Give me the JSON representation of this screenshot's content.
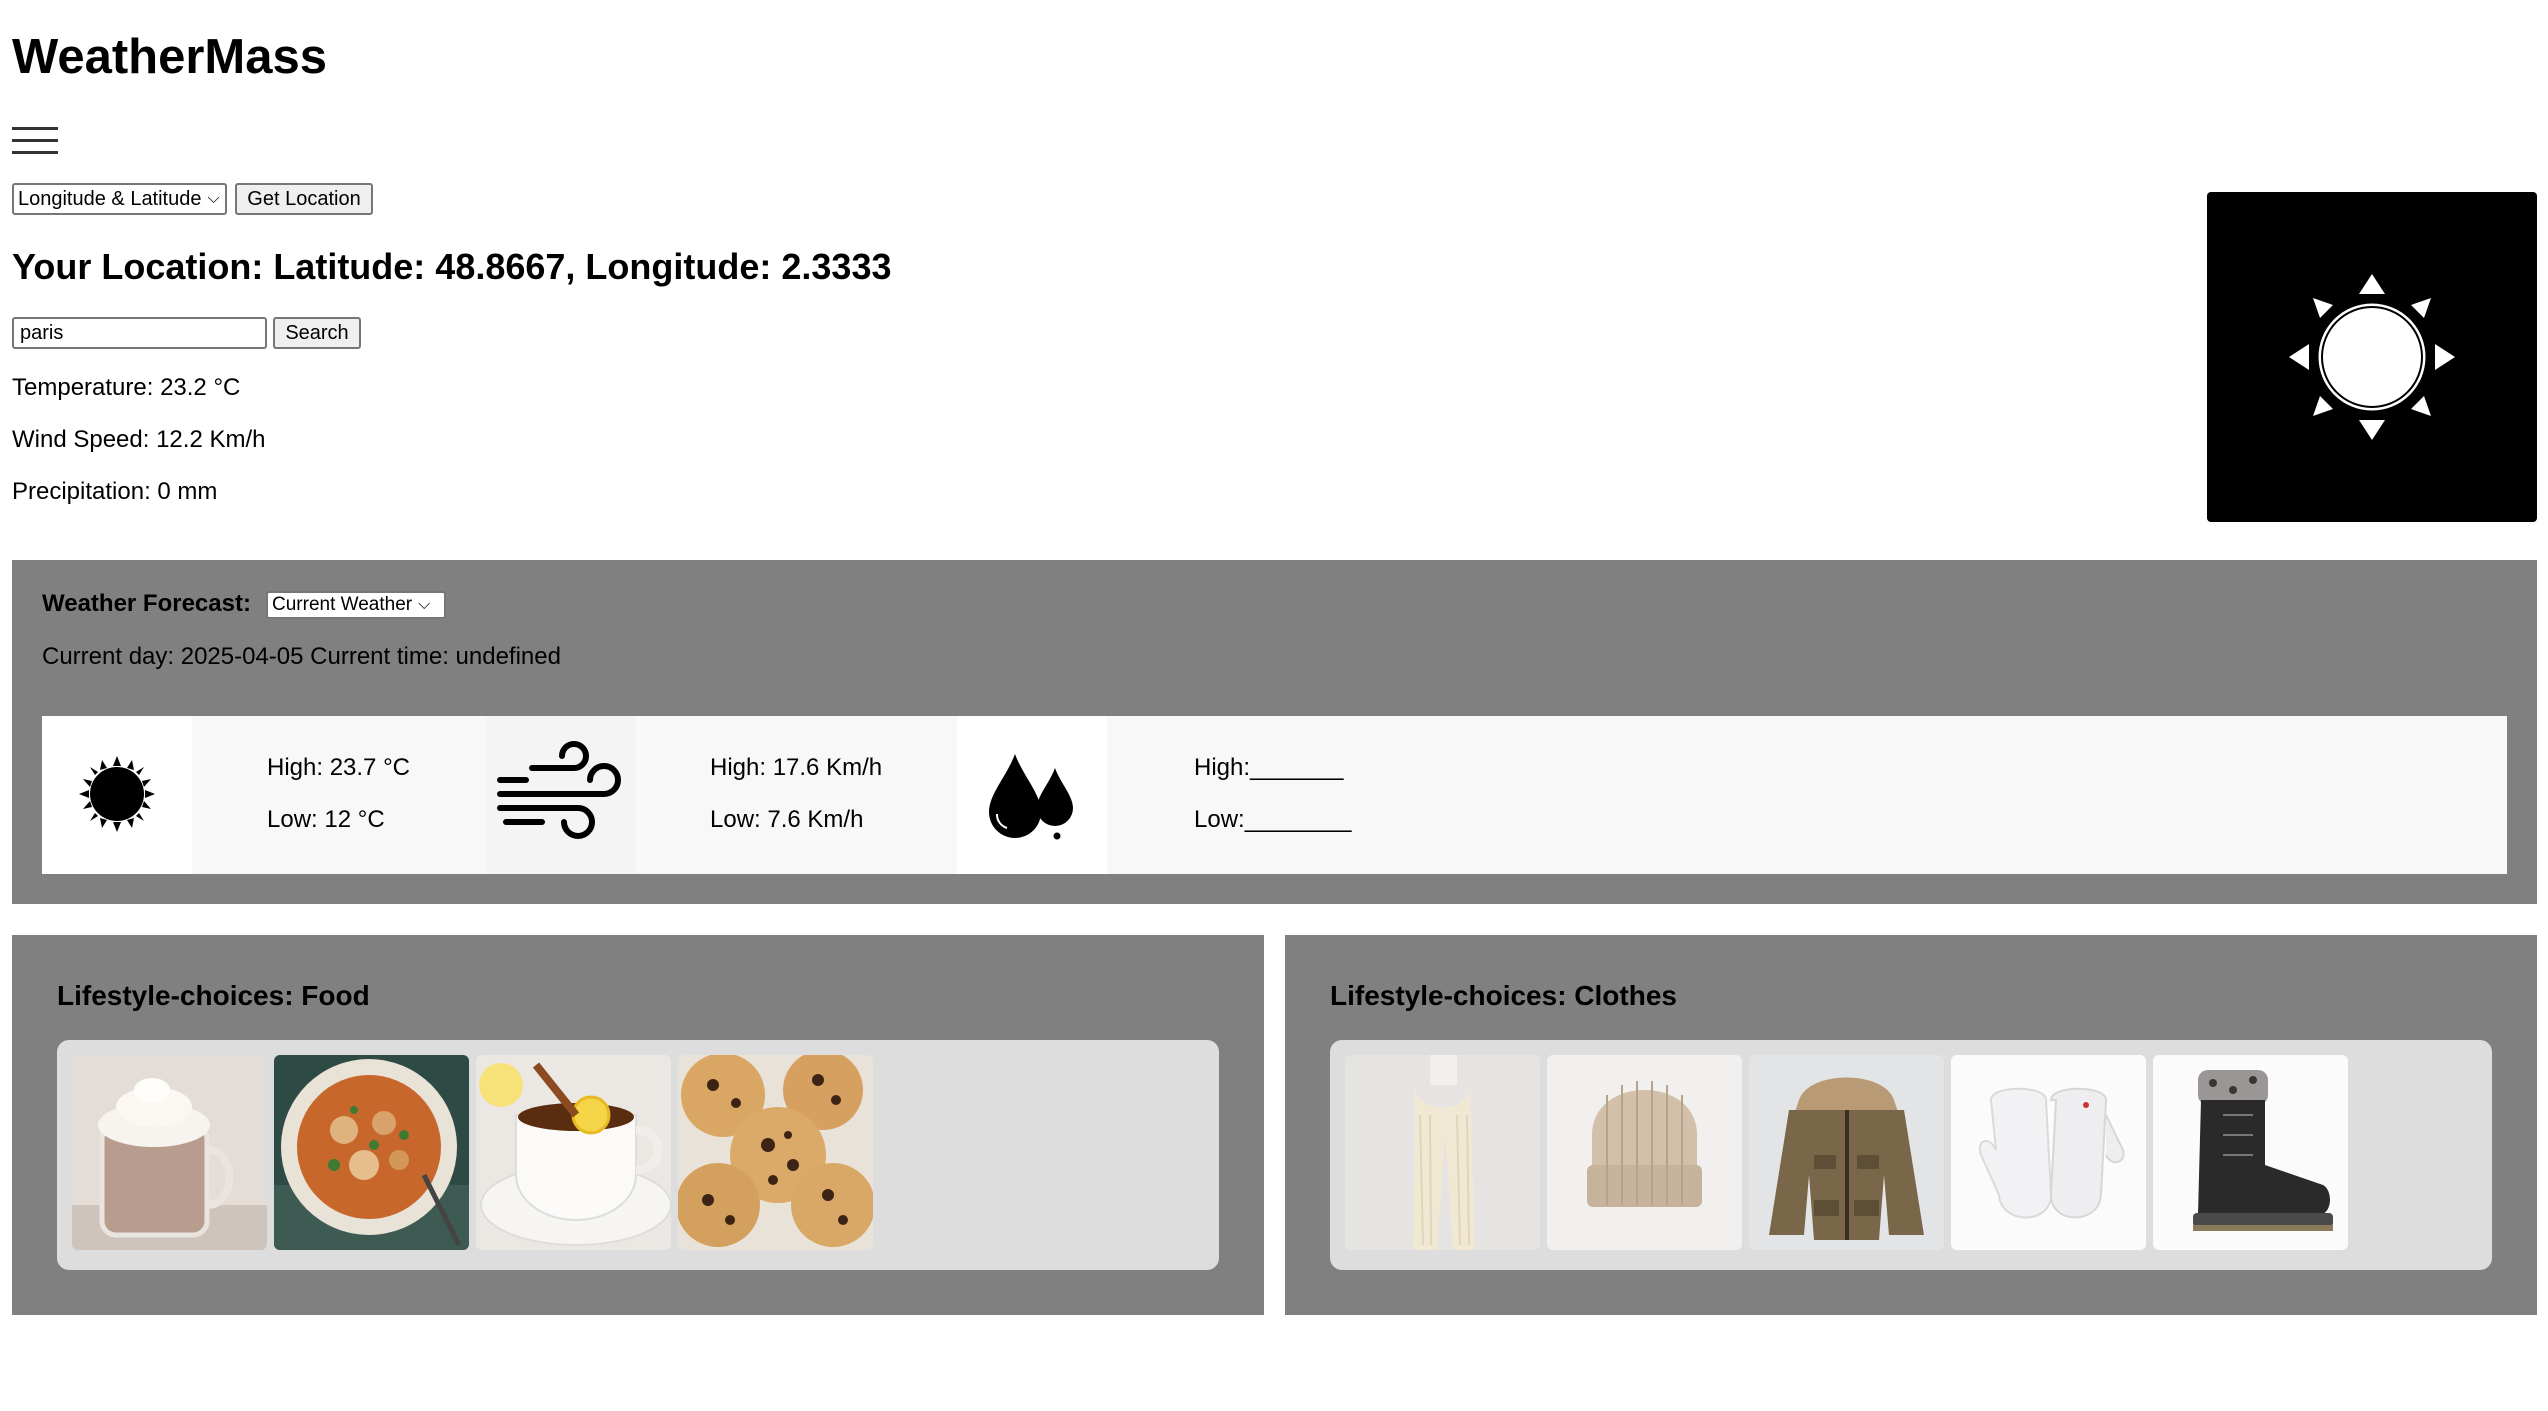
{
  "app": {
    "title": "WeatherMass"
  },
  "location": {
    "mode_select": "Longitude & Latitude",
    "get_location_label": "Get Location",
    "heading": "Your Location: Latitude: 48.8667, Longitude: 2.3333",
    "search_value": "paris",
    "search_label": "Search"
  },
  "current": {
    "temperature": "Temperature: 23.2 °C",
    "wind_speed": "Wind Speed: 12.2 Km/h",
    "precipitation": "Precipitation: 0 mm",
    "condition_icon": "sun-icon"
  },
  "forecast": {
    "label": "Weather Forecast:",
    "select_value": "Current Weather",
    "day_time": "Current day: 2025-04-05 Current time: undefined",
    "temperature": {
      "icon": "sun-icon",
      "high": "High: 23.7 °C",
      "low": "Low: 12 °C"
    },
    "wind": {
      "icon": "wind-icon",
      "high": "High: 17.6 Km/h",
      "low": "Low: 7.6 Km/h"
    },
    "precipitation": {
      "icon": "raindrops-icon",
      "high": "High:_______",
      "low": "Low:________"
    }
  },
  "lifestyle": {
    "food": {
      "title": "Lifestyle-choices: Food",
      "items": [
        "hot-chocolate-image",
        "curry-soup-image",
        "lemon-tea-image",
        "chocolate-chip-cookies-image"
      ]
    },
    "clothes": {
      "title": "Lifestyle-choices: Clothes",
      "items": [
        "scarf-image",
        "beanie-image",
        "parka-jacket-image",
        "mittens-image",
        "winter-boots-image"
      ]
    }
  },
  "colors": {
    "panel_bg": "#808080",
    "gallery_bg": "#dddddd",
    "hero_bg": "#000000"
  }
}
